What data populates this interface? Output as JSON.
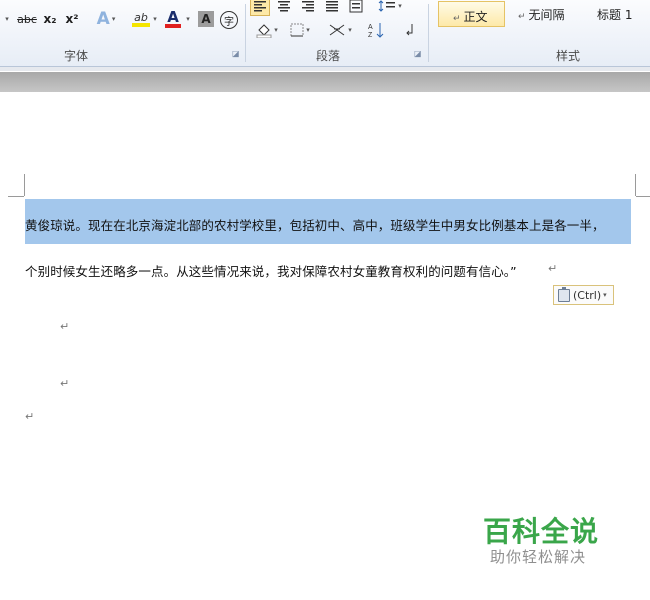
{
  "ribbon": {
    "font_group": {
      "label": "字体",
      "buttons": [
        {
          "name": "strikethrough",
          "text": "abc"
        },
        {
          "name": "subscript",
          "text": "x₂"
        },
        {
          "name": "superscript",
          "text": "x²"
        },
        {
          "name": "text-effects",
          "text": "A"
        },
        {
          "name": "highlight",
          "text": "ab"
        },
        {
          "name": "font-color",
          "text": "A"
        },
        {
          "name": "char-shading",
          "text": "A"
        },
        {
          "name": "enclose-char",
          "text": "字"
        }
      ]
    },
    "paragraph_group": {
      "label": "段落"
    },
    "styles_group": {
      "label": "样式",
      "items": [
        {
          "name": "normal",
          "label": "正文",
          "selected": true
        },
        {
          "name": "no-spacing",
          "label": "无间隔",
          "selected": false
        },
        {
          "name": "heading-1",
          "label": "标题 1",
          "selected": false
        }
      ]
    }
  },
  "document": {
    "line1": "黄俊琼说。现在在北京海淀北部的农村学校里，包括初中、高中，班级学生中男女比例基本上是各一半，",
    "line2": "个别时候女生还略多一点。从这些情况来说，我对保障农村女童教育权利的问题有信心。”",
    "paragraph_mark": "↵",
    "paste_options": "(Ctrl)"
  },
  "watermark": {
    "title": "百科全说",
    "subtitle": "助你轻松解决"
  },
  "colors": {
    "selection": "#a3c7ec",
    "font_color_bar": "#e02020",
    "highlight_bar": "#f4e500",
    "watermark_green": "#3aa64a"
  }
}
